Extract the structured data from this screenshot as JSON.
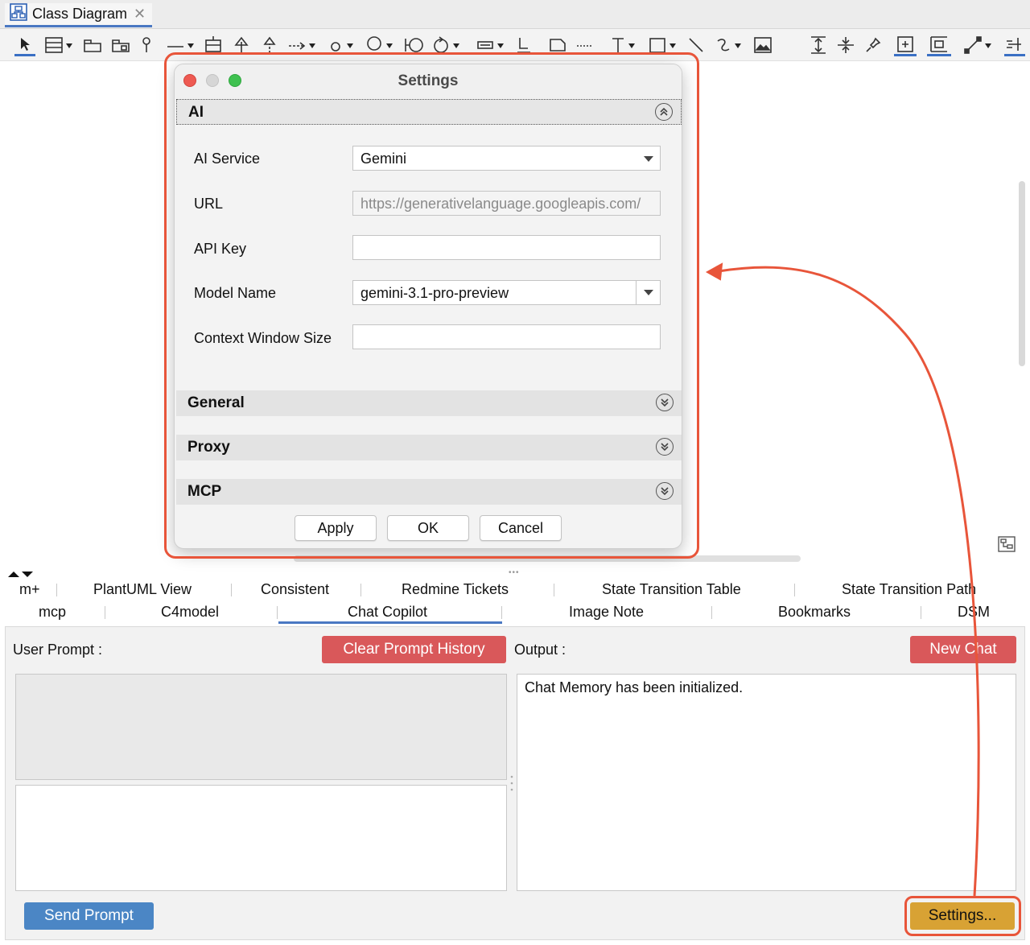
{
  "window": {
    "tab_label": "Class Diagram",
    "tab_icon": "class-diagram-icon",
    "close_icon": "close-icon"
  },
  "settings_dialog": {
    "title": "Settings",
    "sections": {
      "ai": "AI",
      "general": "General",
      "proxy": "Proxy",
      "mcp": "MCP"
    },
    "fields": {
      "ai_service_label": "AI Service",
      "ai_service_value": "Gemini",
      "url_label": "URL",
      "url_value": "https://generativelanguage.googleapis.com/",
      "api_key_label": "API Key",
      "api_key_value": "",
      "model_name_label": "Model Name",
      "model_name_value": "gemini-3.1-pro-preview",
      "context_window_label": "Context Window Size",
      "context_window_value": ""
    },
    "buttons": {
      "apply": "Apply",
      "ok": "OK",
      "cancel": "Cancel"
    }
  },
  "bottom_tabs": {
    "row1": [
      "m+",
      "PlantUML View",
      "Consistent",
      "Redmine Tickets",
      "State Transition Table",
      "State Transition Path"
    ],
    "row2": [
      "mcp",
      "C4model",
      "Chat Copilot",
      "Image Note",
      "Bookmarks",
      "DSM"
    ],
    "active": "Chat Copilot"
  },
  "chat": {
    "user_prompt_label": "User Prompt :",
    "clear_history_button": "Clear Prompt History",
    "output_label": "Output :",
    "new_chat_button": "New Chat",
    "output_text": "Chat Memory has been initialized.",
    "send_button": "Send Prompt",
    "settings_button": "Settings..."
  },
  "colors": {
    "highlight": "#e8553a",
    "red_button": "#d9585a",
    "blue_button": "#4b86c5",
    "settings_button": "#d8a234",
    "active_tab": "#4a78c2"
  }
}
